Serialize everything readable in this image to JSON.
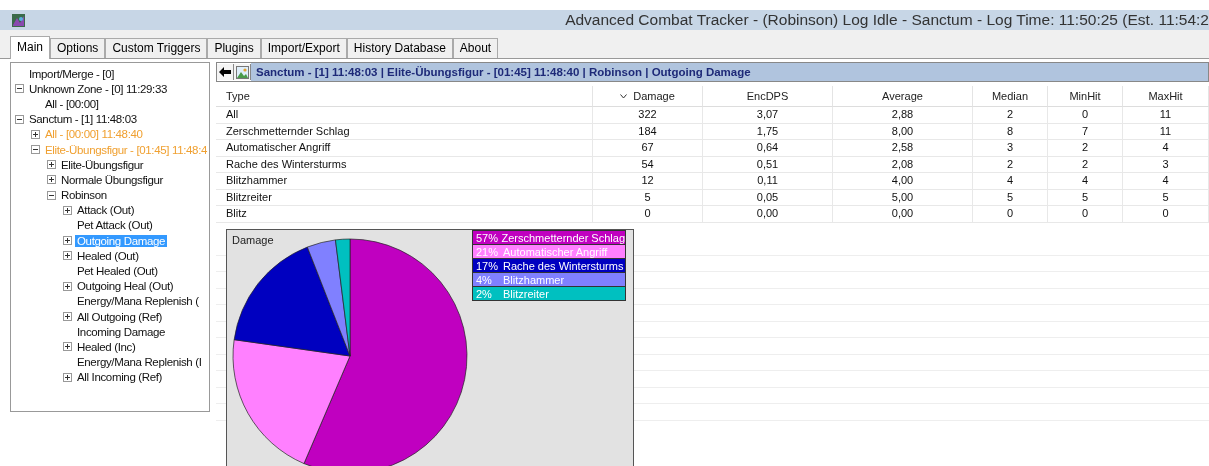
{
  "window": {
    "title": "Advanced Combat Tracker - (Robinson) Log Idle - Sanctum - Log Time: 11:50:25 (Est. 11:54:2"
  },
  "tabs": [
    {
      "label": "Main",
      "selected": true
    },
    {
      "label": "Options",
      "selected": false
    },
    {
      "label": "Custom Triggers",
      "selected": false
    },
    {
      "label": "Plugins",
      "selected": false
    },
    {
      "label": "Import/Export",
      "selected": false
    },
    {
      "label": "History Database",
      "selected": false
    },
    {
      "label": "About",
      "selected": false
    }
  ],
  "tree": [
    {
      "label": "Import/Merge - [0]",
      "kind": "leaf",
      "selected": false
    },
    {
      "label": "Unknown Zone - [0] 11:29:33",
      "kind": "node",
      "expanded": true,
      "selected": false,
      "children": [
        {
          "label": "All - [00:00]",
          "kind": "leaf",
          "selected": false
        }
      ]
    },
    {
      "label": "Sanctum - [1] 11:48:03",
      "kind": "node",
      "expanded": true,
      "selected": false,
      "children": [
        {
          "label": "All - [00:00] 11:48:40",
          "kind": "node",
          "expanded": false,
          "selected": false,
          "color": "#f0a030"
        },
        {
          "label": "Elite-Übungsfigur - [01:45] 11:48:4",
          "kind": "node",
          "expanded": true,
          "selected": false,
          "color": "#f0a030",
          "children": [
            {
              "label": "Elite-Übungsfigur",
              "kind": "node",
              "expanded": false,
              "selected": false
            },
            {
              "label": "Normale Übungsfigur",
              "kind": "node",
              "expanded": false,
              "selected": false
            },
            {
              "label": "Robinson",
              "kind": "node",
              "expanded": true,
              "selected": false,
              "children": [
                {
                  "label": "Attack (Out)",
                  "kind": "node",
                  "expanded": false,
                  "selected": false
                },
                {
                  "label": "Pet Attack (Out)",
                  "kind": "leaf",
                  "selected": false
                },
                {
                  "label": "Outgoing Damage",
                  "kind": "node",
                  "expanded": false,
                  "selected": true
                },
                {
                  "label": "Healed (Out)",
                  "kind": "node",
                  "expanded": false,
                  "selected": false
                },
                {
                  "label": "Pet Healed (Out)",
                  "kind": "leaf",
                  "selected": false
                },
                {
                  "label": "Outgoing Heal (Out)",
                  "kind": "node",
                  "expanded": false,
                  "selected": false
                },
                {
                  "label": "Energy/Mana Replenish (",
                  "kind": "leaf",
                  "selected": false
                },
                {
                  "label": "All Outgoing (Ref)",
                  "kind": "node",
                  "expanded": false,
                  "selected": false
                },
                {
                  "label": "Incoming Damage",
                  "kind": "leaf",
                  "selected": false
                },
                {
                  "label": "Healed (Inc)",
                  "kind": "node",
                  "expanded": false,
                  "selected": false
                },
                {
                  "label": "Energy/Mana Replenish (I",
                  "kind": "leaf",
                  "selected": false
                },
                {
                  "label": "All Incoming (Ref)",
                  "kind": "node",
                  "expanded": false,
                  "selected": false
                }
              ]
            }
          ]
        }
      ]
    }
  ],
  "breadcrumb": "Sanctum - [1] 11:48:03 | Elite-Übungsfigur - [01:45] 11:48:40 | Robinson | Outgoing Damage",
  "table": {
    "columns": [
      {
        "label": "Type",
        "sorted": false
      },
      {
        "label": "Damage",
        "sorted": true
      },
      {
        "label": "EncDPS",
        "sorted": false
      },
      {
        "label": "Average",
        "sorted": false
      },
      {
        "label": "Median",
        "sorted": false
      },
      {
        "label": "MinHit",
        "sorted": false
      },
      {
        "label": "MaxHit",
        "sorted": false
      }
    ],
    "rows": [
      [
        "All",
        "322",
        "3,07",
        "2,88",
        "2",
        "0",
        "11"
      ],
      [
        "Zerschmetternder Schlag",
        "184",
        "1,75",
        "8,00",
        "8",
        "7",
        "11"
      ],
      [
        "Automatischer Angriff",
        "67",
        "0,64",
        "2,58",
        "3",
        "2",
        "4"
      ],
      [
        "Rache des Wintersturms",
        "54",
        "0,51",
        "2,08",
        "2",
        "2",
        "3"
      ],
      [
        "Blitzhammer",
        "12",
        "0,11",
        "4,00",
        "4",
        "4",
        "4"
      ],
      [
        "Blitzreiter",
        "5",
        "0,05",
        "5,00",
        "5",
        "5",
        "5"
      ],
      [
        "Blitz",
        "0",
        "0,00",
        "0,00",
        "0",
        "0",
        "0"
      ]
    ]
  },
  "chart": {
    "chart_data": {
      "type": "pie",
      "title": "Damage",
      "categories": [
        "Zerschmetternder Schlag",
        "Automatischer Angriff",
        "Rache des Wintersturms",
        "Blitzhammer",
        "Blitzreiter"
      ],
      "values": [
        57,
        21,
        17,
        4,
        2
      ]
    },
    "legend": [
      {
        "percent": "57%",
        "color": "#c000c0"
      },
      {
        "percent": "21%",
        "color": "#ff80ff"
      },
      {
        "percent": "17%",
        "color": "#0000c0"
      },
      {
        "percent": "4%",
        "color": "#8080ff"
      },
      {
        "percent": "2%",
        "color": "#00c0c0"
      }
    ]
  }
}
